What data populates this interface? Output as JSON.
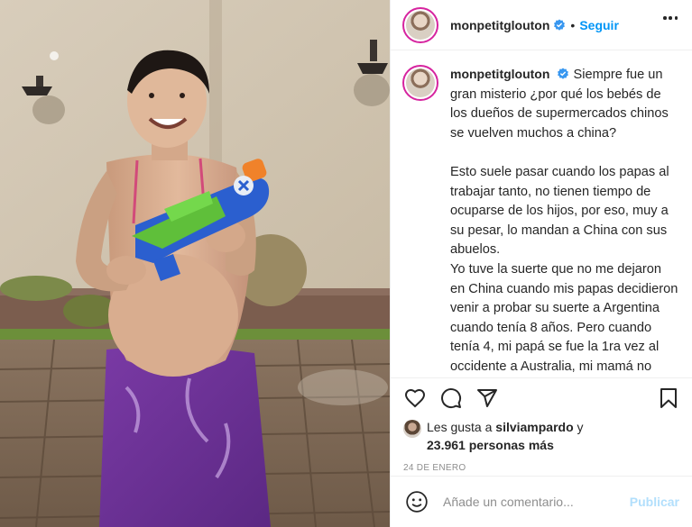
{
  "post": {
    "username": "monpetitglouton",
    "follow_label": "Seguir",
    "separator": "•",
    "more_icon": "more-horizontal-icon",
    "verified_icon": "verified-badge-icon"
  },
  "caption": {
    "username": "monpetitglouton",
    "paragraphs": [
      "Siempre fue un gran misterio ¿por qué los bebés de los dueños de supermercados chinos se vuelven muchos a china?",
      "Esto suele pasar cuando los papas al trabajar tanto, no tienen tiempo de ocuparse de los hijos, por eso, muy a su pesar, lo mandan a China con sus abuelos.",
      "Yo tuve la suerte que no me dejaron en China cuando mis papas decidieron venir a probar su suerte a Argentina cuando tenía 8 años. Pero cuando tenía 4, mi papá se fue la 1ra vez al occidente a Australia, mi mamá no podía cuidarme y trabajar, tampoco alcanzaba para contratar una niñera, me puso en un jardín de"
    ]
  },
  "actions": {
    "like_icon": "heart-icon",
    "comment_icon": "comment-icon",
    "share_icon": "send-icon",
    "save_icon": "bookmark-icon"
  },
  "likes": {
    "prefix": "Les gusta a ",
    "liked_by": "silviampardo",
    "connector": " y",
    "others": "23.961 personas más"
  },
  "date": "24 DE ENERO",
  "comment": {
    "emoji_icon": "emoji-icon",
    "placeholder": "Añade un comentario...",
    "post_label": "Publicar"
  },
  "colors": {
    "accent": "#0095f6",
    "post_disabled": "#b2dffc",
    "text": "#262626",
    "muted": "#8e8e8e",
    "border": "#efefef"
  }
}
